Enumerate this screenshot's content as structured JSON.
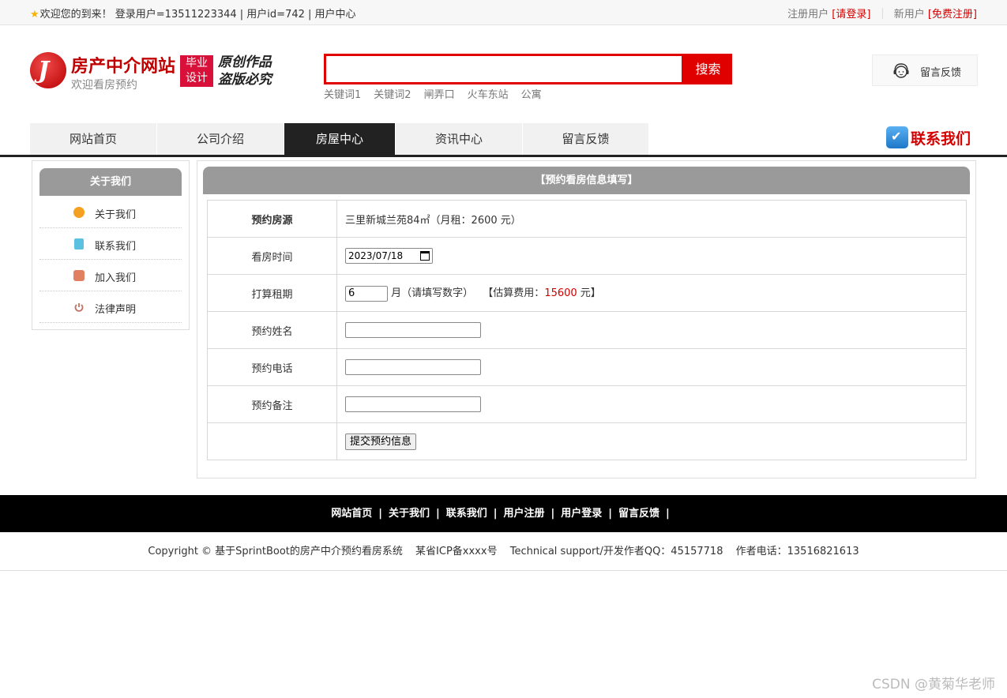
{
  "topbar": {
    "welcome": "欢迎您的到来！ 登录用户=13511223344 | 用户id=742 | 用户中心",
    "register_user": "注册用户",
    "login_link": "[请登录]",
    "new_user": "新用户",
    "free_register": "[免费注册]"
  },
  "header": {
    "site_title": "房产中介网站",
    "site_subtitle": "欢迎看房预约",
    "badge_line1": "毕业",
    "badge_line2": "设计",
    "slogan_line1": "原创作品",
    "slogan_line2": "盗版必究",
    "search_button": "搜索",
    "keywords": [
      "关键词1",
      "关键词2",
      "闸弄口",
      "火车东站",
      "公寓"
    ],
    "feedback": "留言反馈"
  },
  "nav": {
    "items": [
      "网站首页",
      "公司介绍",
      "房屋中心",
      "资讯中心",
      "留言反馈"
    ],
    "active_index": 2,
    "contact": "联系我们"
  },
  "sidebar": {
    "title": "关于我们",
    "items": [
      {
        "label": "关于我们",
        "icon": "coin-icon",
        "color": "#f5a020"
      },
      {
        "label": "联系我们",
        "icon": "clipboard-icon",
        "color": "#5cc0e0"
      },
      {
        "label": "加入我们",
        "icon": "lock-icon",
        "color": "#e08060"
      },
      {
        "label": "法律声明",
        "icon": "power-icon",
        "color": "#c07060"
      }
    ]
  },
  "form": {
    "title": "【预约看房信息填写】",
    "source_label": "预约房源",
    "source_value": "三里新城兰苑84㎡（月租：2600 元）",
    "time_label": "看房时间",
    "time_value": "2023/07/18",
    "lease_label": "打算租期",
    "lease_value": "6",
    "lease_hint": "月（请填写数字）",
    "estimate_prefix": "【估算费用：",
    "estimate_value": "15600",
    "estimate_suffix": " 元】",
    "name_label": "预约姓名",
    "phone_label": "预约电话",
    "note_label": "预约备注",
    "submit": "提交预约信息"
  },
  "footer": {
    "links": [
      "网站首页",
      "关于我们",
      "联系我们",
      "用户注册",
      "用户登录",
      "留言反馈"
    ],
    "copyright": "Copyright © 基于SprintBoot的房产中介预约看房系统",
    "icp": "某省ICP备xxxx号",
    "support": "Technical support/开发作者QQ：45157718",
    "phone": "作者电话：13516821613"
  },
  "watermark": "CSDN @黄菊华老师",
  "colors": {
    "accent": "#e00000",
    "nav_active": "#222222",
    "panel_head": "#9a9a9a"
  }
}
